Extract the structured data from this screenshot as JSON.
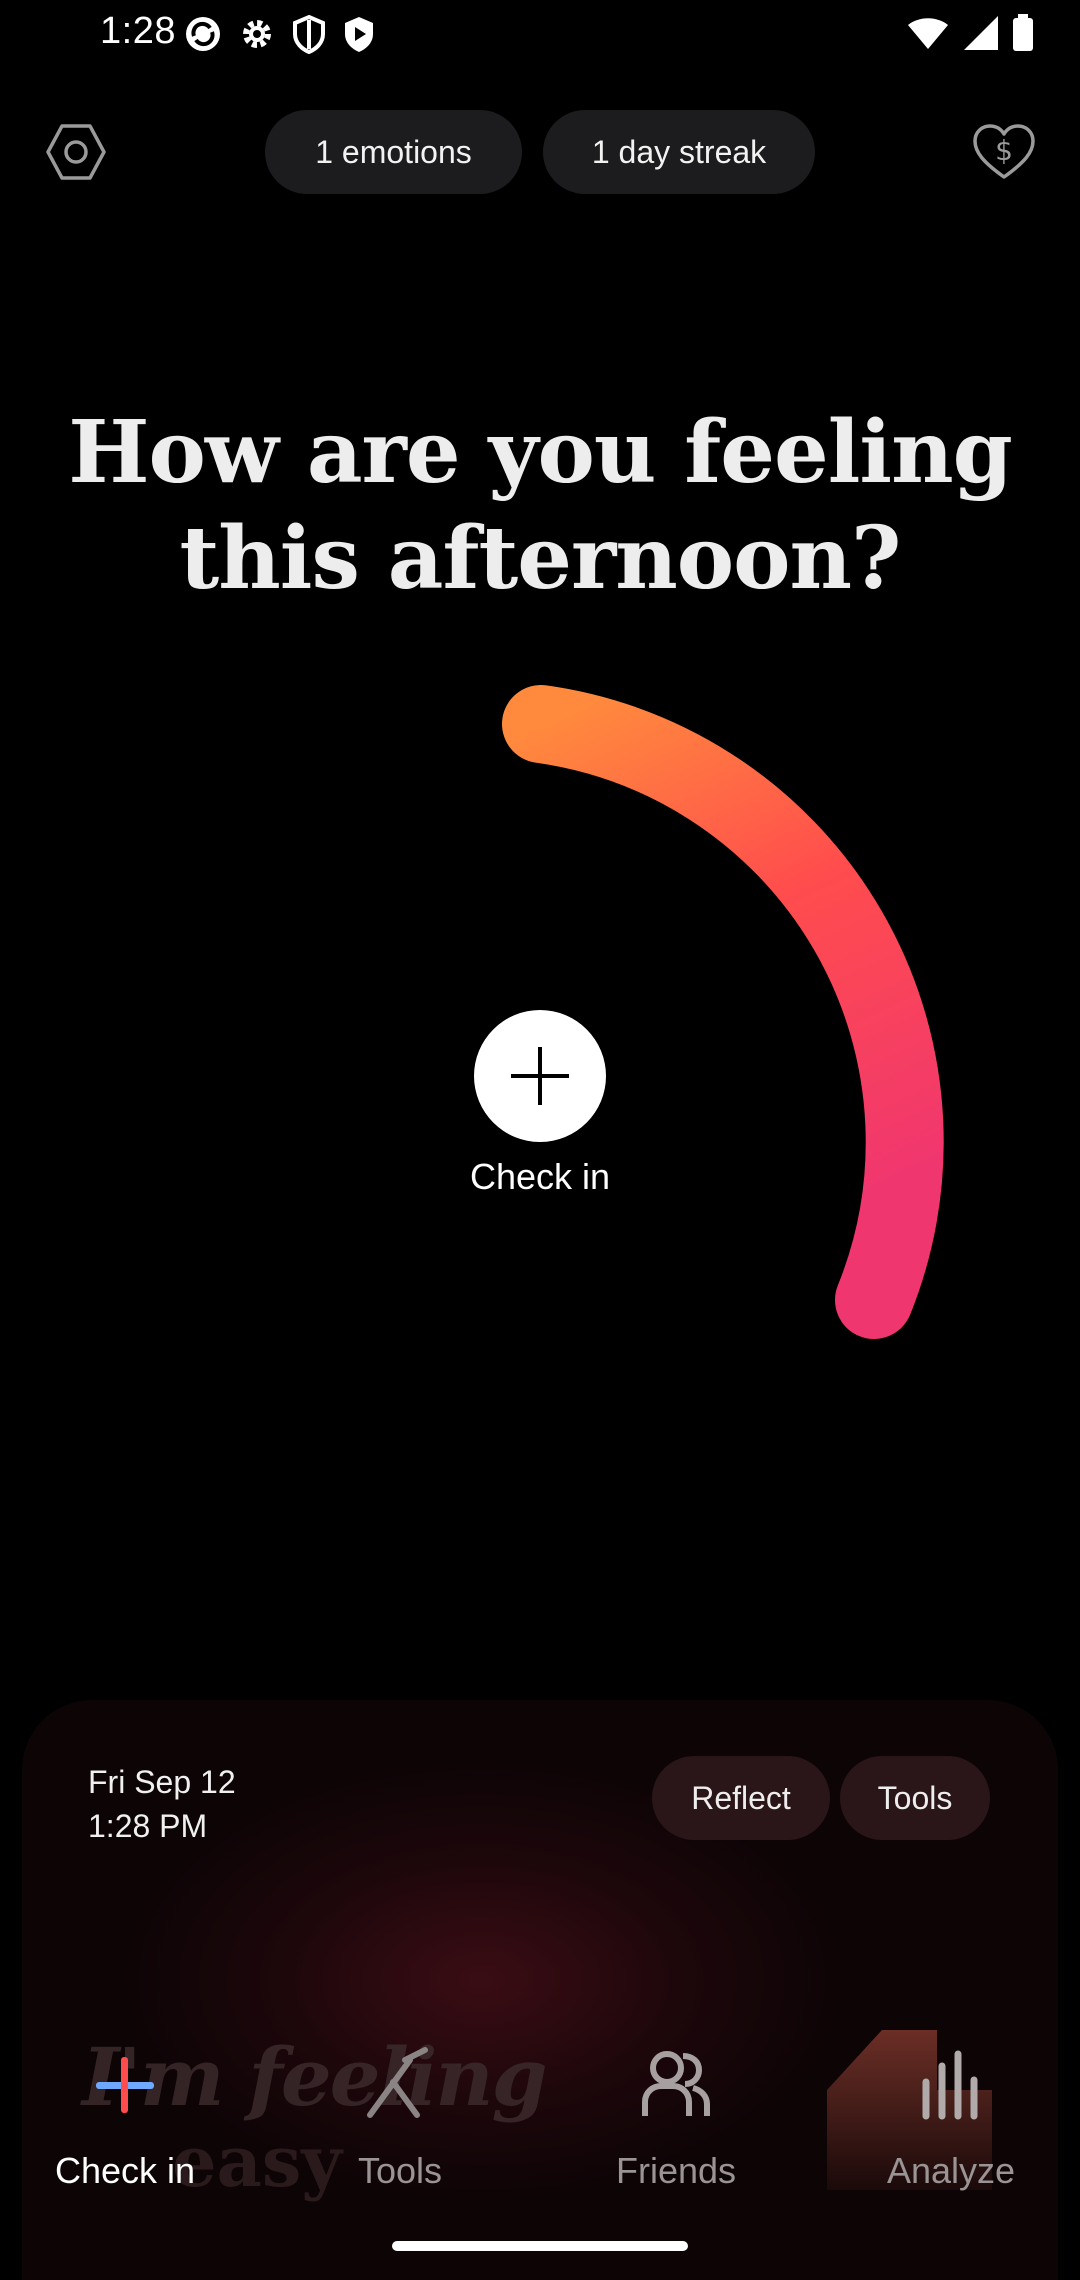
{
  "status_bar": {
    "time": "1:28"
  },
  "header": {
    "emotions_pill": "1 emotions",
    "streak_pill": "1 day streak"
  },
  "main": {
    "question": "How are you feeling this afternoon?",
    "checkin_label": "Check in",
    "arc_colors": [
      "#ff8a3d",
      "#ff4d4d",
      "#f0366f"
    ]
  },
  "card": {
    "date": "Fri Sep 12",
    "time": "1:28 PM",
    "reflect_label": "Reflect",
    "tools_label": "Tools",
    "faded_line1": "I'm feeling",
    "faded_line2": "easy"
  },
  "nav": {
    "items": [
      {
        "label": "Check in",
        "icon": "check-in-icon",
        "active": true
      },
      {
        "label": "Tools",
        "icon": "tools-icon",
        "active": false
      },
      {
        "label": "Friends",
        "icon": "friends-icon",
        "active": false
      },
      {
        "label": "Analyze",
        "icon": "analyze-icon",
        "active": false
      }
    ]
  }
}
